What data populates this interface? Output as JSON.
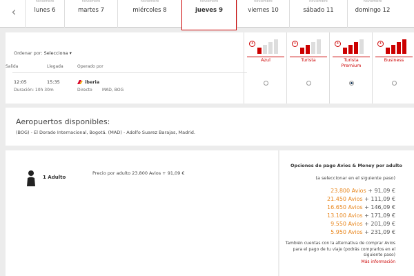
{
  "nav": {
    "prev_arrow": "‹",
    "days": [
      {
        "month": "noviembre",
        "label": "lunes 6",
        "selected": false
      },
      {
        "month": "noviembre",
        "label": "martes 7",
        "selected": false
      },
      {
        "month": "noviembre",
        "label": "miércoles 8",
        "selected": false
      },
      {
        "month": "noviembre",
        "label": "jueves 9",
        "selected": true
      },
      {
        "month": "noviembre",
        "label": "viernes 10",
        "selected": false
      },
      {
        "month": "noviembre",
        "label": "sábado 11",
        "selected": false
      },
      {
        "month": "noviembre",
        "label": "domingo 12",
        "selected": false
      }
    ]
  },
  "flights": {
    "order_label": "Ordenar por:",
    "order_value": "Selecciona ▾",
    "headers": {
      "departure": "Salida",
      "arrival": "Llegada",
      "operator": "Operado por"
    },
    "row": {
      "departure": "12:05",
      "arrival": "15:35",
      "operator": "iberia",
      "duration": "Duración: 10h 30m",
      "type": "Directo",
      "route": "MAD, BOG"
    },
    "fares": [
      {
        "name": "Azul",
        "selected": false
      },
      {
        "name": "Turista",
        "selected": false
      },
      {
        "name": "Turista Premium",
        "selected": true
      },
      {
        "name": "Business",
        "selected": false
      }
    ]
  },
  "airports": {
    "title": "Aeropuertos disponibles:",
    "text": "(BOG) - El Dorado Internacional, Bogotá. (MAD) - Adolfo Suarez Barajas, Madrid."
  },
  "passengers": {
    "label": "1 Adulto",
    "per_adult": "Precio por adulto 23.800 Avios + 91,09 €"
  },
  "payment": {
    "title": "Opciones de pago Avios & Money por adulto",
    "subtitle": "(a seleccionar en el siguiente paso)",
    "options": [
      {
        "avios": "23.800 Avios",
        "money": "+ 91,09 €"
      },
      {
        "avios": "21.450 Avios",
        "money": "+ 111,09 €"
      },
      {
        "avios": "16.650 Avios",
        "money": "+ 146,09 €"
      },
      {
        "avios": "13.100 Avios",
        "money": "+ 171,09 €"
      },
      {
        "avios": "9.550 Avios",
        "money": "+ 201,09 €"
      },
      {
        "avios": "5.950 Avios",
        "money": "+ 231,09 €"
      }
    ],
    "note": "También cuentas con la alternativa de comprar Avios para el pago de tu viaje (podrás comprarlos en el siguiente paso)",
    "more_link": "Más información"
  },
  "colors": {
    "accent": "#cc0000",
    "avios": "#e8871e"
  }
}
